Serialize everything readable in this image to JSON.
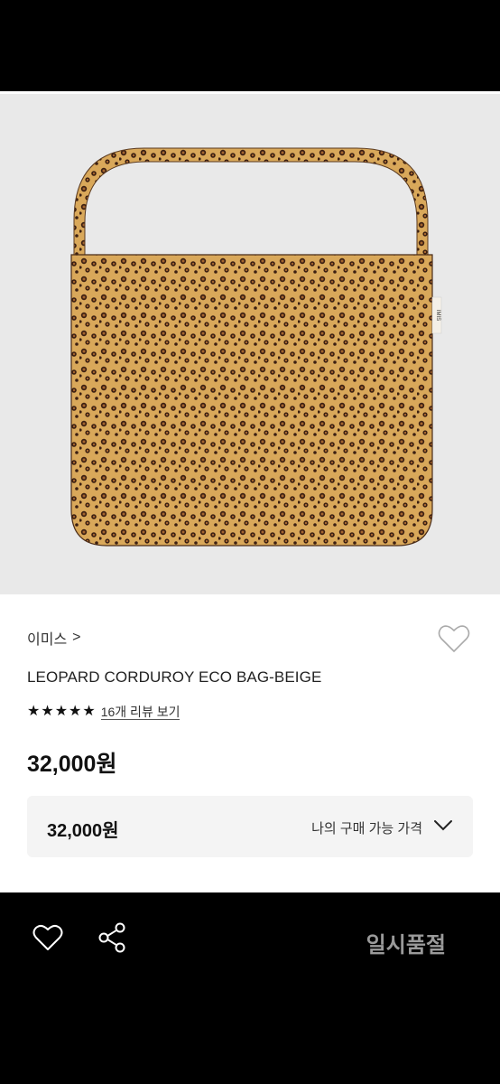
{
  "product": {
    "brand": "이미스",
    "brand_chevron": ">",
    "title": "LEOPARD CORDUROY ECO BAG-BEIGE",
    "rating_stars": 5,
    "review_text": "16개 리뷰 보기",
    "price": "32,000원",
    "image_label": "IMIS"
  },
  "purchase": {
    "price": "32,000원",
    "label": "나의 구매 가능 가격"
  },
  "bottom_bar": {
    "status": "일시품절"
  },
  "colors": {
    "bag_base": "#d9a85a",
    "spot": "#3b1f12",
    "background": "#e9e9e9"
  }
}
